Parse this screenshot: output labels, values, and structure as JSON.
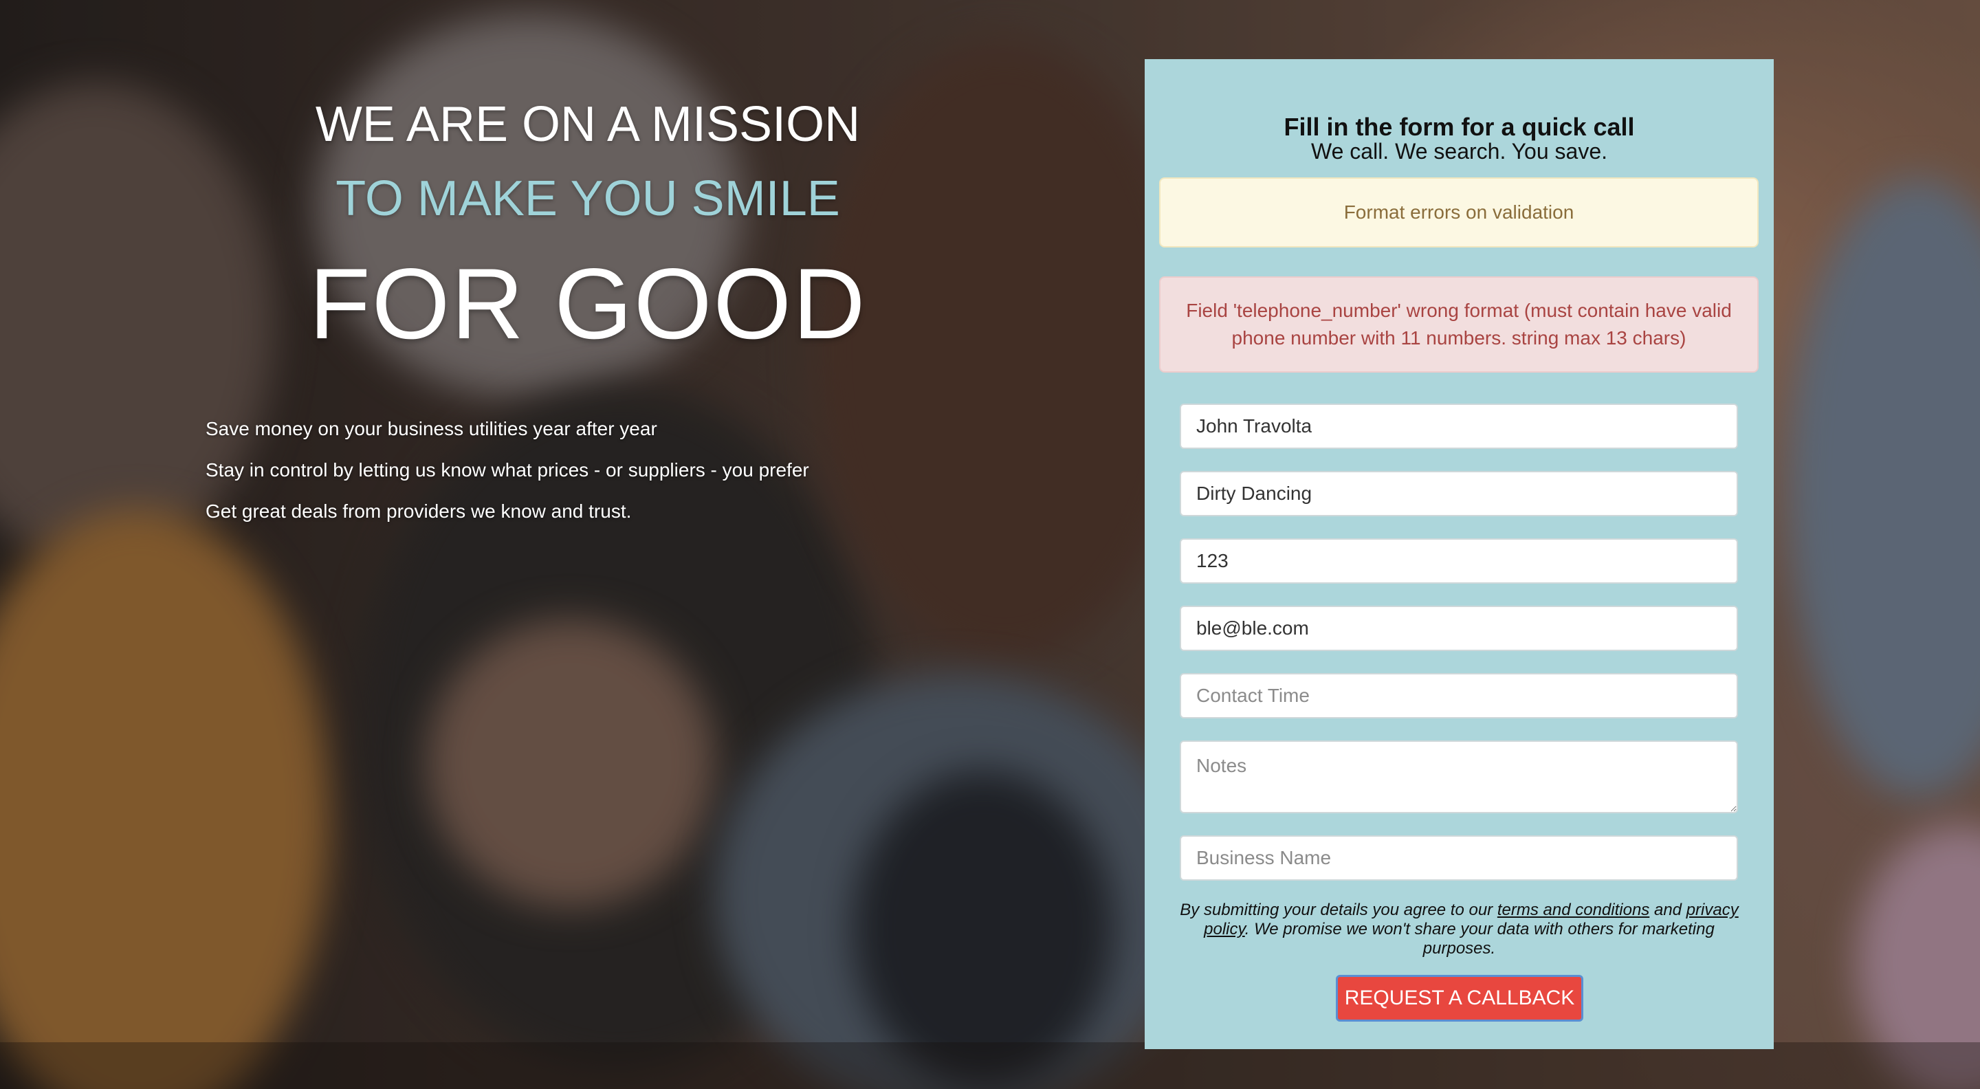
{
  "hero": {
    "line1": "WE ARE ON A MISSION",
    "line2": "TO MAKE YOU SMILE",
    "line3": "FOR GOOD",
    "bullets": [
      "Save money on your business utilities year after year",
      "Stay in control by letting us know what prices - or suppliers - you prefer",
      "Get great deals from providers we know and trust."
    ]
  },
  "form": {
    "title": "Fill in the form for a quick call",
    "subtitle": "We call. We search. You save.",
    "warning": "Format errors on validation",
    "error": "Field 'telephone_number' wrong format (must contain have valid phone number with 11 numbers. string max 13 chars)",
    "fields": {
      "name": {
        "value": "John Travolta",
        "placeholder": ""
      },
      "surname": {
        "value": "Dirty Dancing",
        "placeholder": ""
      },
      "telephone": {
        "value": "123",
        "placeholder": ""
      },
      "email": {
        "value": "ble@ble.com",
        "placeholder": ""
      },
      "contact_time": {
        "value": "",
        "placeholder": "Contact Time"
      },
      "notes": {
        "value": "",
        "placeholder": "Notes"
      },
      "business_name": {
        "value": "",
        "placeholder": "Business Name"
      }
    },
    "consent": {
      "before": "By submitting your details you agree to our ",
      "terms_link": "terms and conditions",
      "middle": " and ",
      "privacy_link": "privacy policy",
      "after": ". We promise we won't share your data with others for marketing purposes."
    },
    "submit_label": "REQUEST A CALLBACK"
  },
  "colors": {
    "panel": "#acd6db",
    "accent_heading": "#9fd3d9",
    "cta": "#e8473f",
    "warning_bg": "#fcf8e3",
    "error_bg": "#f2dede"
  }
}
